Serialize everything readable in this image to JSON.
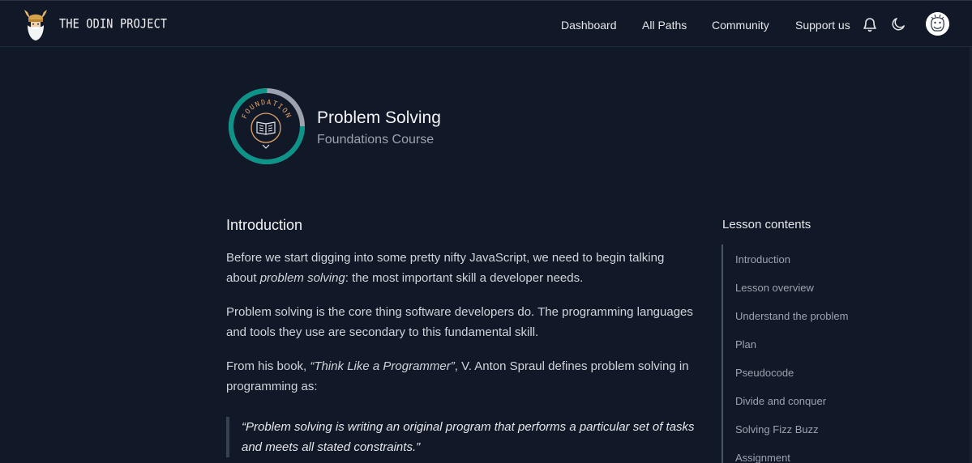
{
  "brand": {
    "name": "THE ODIN PROJECT",
    "logo_icon": "odin-viking-logo-icon"
  },
  "nav": {
    "links": [
      "Dashboard",
      "All Paths",
      "Community",
      "Support us"
    ],
    "notification_icon": "bell-icon",
    "theme_icon": "moon-icon",
    "avatar_icon": "user-avatar-icon"
  },
  "course": {
    "badge_text": "FOUNDATION",
    "badge_progress": 0.75,
    "title": "Problem Solving",
    "subtitle": "Foundations Course"
  },
  "lesson": {
    "heading": "Introduction",
    "p1_a": "Before we start digging into some pretty nifty JavaScript, we need to begin talking about ",
    "p1_em": "problem solving",
    "p1_b": ": the most important skill a developer needs.",
    "p2": "Problem solving is the core thing software developers do. The programming languages and tools they use are secondary to this fundamental skill.",
    "p3_a": "From his book, ",
    "p3_em": "“Think Like a Programmer”",
    "p3_b": ", V. Anton Spraul defines problem solving in programming as:",
    "quote": "“Problem solving is writing an original program that performs a particular set of tasks and meets all stated constraints.”"
  },
  "toc": {
    "title": "Lesson contents",
    "items": [
      "Introduction",
      "Lesson overview",
      "Understand the problem",
      "Plan",
      "Pseudocode",
      "Divide and conquer",
      "Solving Fizz Buzz",
      "Assignment"
    ]
  },
  "colors": {
    "background": "#111827",
    "accent_teal": "#0d9488",
    "ring_grey": "#9ca3af"
  }
}
